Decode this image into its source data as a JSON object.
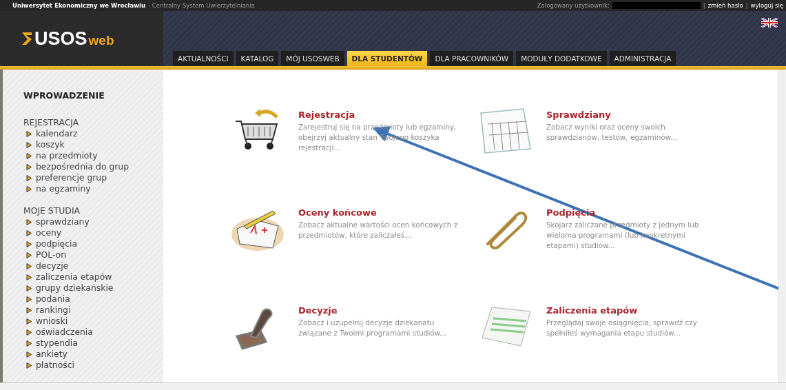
{
  "top_bar": {
    "institution": "Uniwersytet Ekonomiczny we Wrocławiu",
    "subtitle": "- Centralny System Uwierzytelniania",
    "logged_label": "Zalogowany użytkownik:",
    "links": [
      "zmień hasło",
      "wyloguj się"
    ],
    "separator": "|"
  },
  "logo": {
    "main": "USOS",
    "suffix": "web"
  },
  "tabs": [
    {
      "label": "AKTUALNOŚCI",
      "selected": false
    },
    {
      "label": "KATALOG",
      "selected": false
    },
    {
      "label": "MÓJ USOSWEB",
      "selected": false
    },
    {
      "label": "DLA STUDENTÓW",
      "selected": true
    },
    {
      "label": "DLA PRACOWNIKÓW",
      "selected": false
    },
    {
      "label": "MODUŁY DODATKOWE",
      "selected": false
    },
    {
      "label": "ADMINISTRACJA",
      "selected": false
    }
  ],
  "sidebar": {
    "heading": "WPROWADZENIE",
    "sections": [
      {
        "title": "REJESTRACJA",
        "items": [
          "kalendarz",
          "koszyk",
          "na przedmioty",
          "bezpośrednia do grup",
          "preferencje grup",
          "na egzaminy"
        ]
      },
      {
        "title": "MOJE STUDIA",
        "items": [
          "sprawdziany",
          "oceny",
          "podpięcia",
          "POL-on",
          "decyzje",
          "zaliczenia etapów",
          "grupy dziekańskie",
          "podania",
          "rankingi",
          "wnioski",
          "oświadczenia",
          "stypendia",
          "ankiety",
          "płatności"
        ]
      }
    ]
  },
  "cards": [
    {
      "title": "Rejestracja",
      "description": "Zarejestruj się na przedmioty lub egzaminy, obejrzyj aktualny stan Twojego koszyka rejestracji..."
    },
    {
      "title": "Sprawdziany",
      "description": "Zobacz wyniki oraz oceny swoich sprawdzianów, testów, egzaminów..."
    },
    {
      "title": "Oceny końcowe",
      "description": "Zobacz aktualne wartości ocen końcowych z przedmiotów, które zaliczałeś..."
    },
    {
      "title": "Podpięcia",
      "description": "Skojarz zaliczane przedmioty z jednym lub wieloma programami (lub konkretnymi etapami) studiów..."
    },
    {
      "title": "Decyzje",
      "description": "Zobacz i uzupełnij decyzje dziekanatu związane z Twoimi programami studiów..."
    },
    {
      "title": "Zaliczenia etapów",
      "description": "Przeglądaj swoje osiągnięcia, sprawdź czy spełniłeś wymagania etapu studiów..."
    }
  ]
}
